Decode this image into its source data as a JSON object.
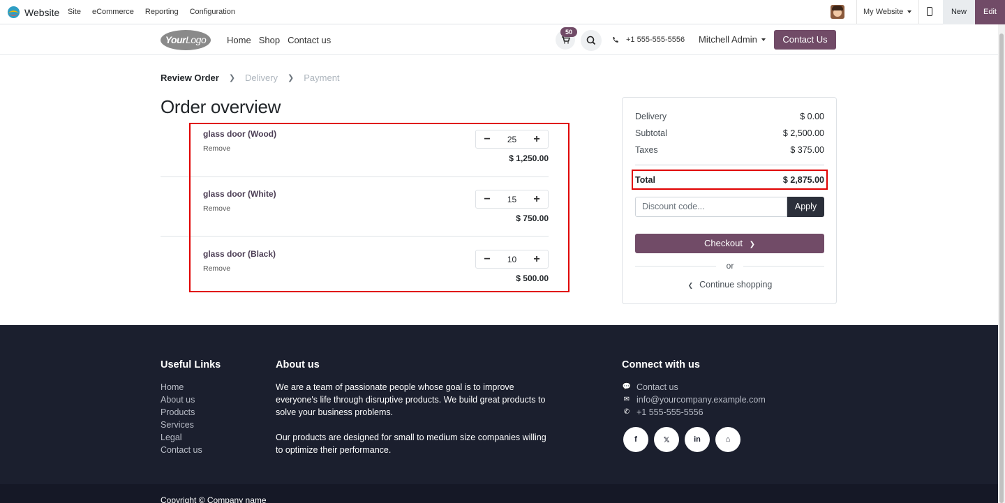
{
  "adminbar": {
    "app_name": "Website",
    "menu": [
      "Site",
      "eCommerce",
      "Reporting",
      "Configuration"
    ],
    "website_selector": "My Website",
    "new_label": "New",
    "edit_label": "Edit"
  },
  "header": {
    "logo_bold": "Your",
    "logo_thin": "Logo",
    "nav": [
      "Home",
      "Shop",
      "Contact us"
    ],
    "cart_count": "50",
    "phone": "+1 555-555-5556",
    "user": "Mitchell Admin",
    "contact_button": "Contact Us"
  },
  "steps": {
    "review": "Review Order",
    "delivery": "Delivery",
    "payment": "Payment"
  },
  "page_title": "Order overview",
  "order_lines": [
    {
      "name": "glass door (Wood)",
      "remove": "Remove",
      "qty": "25",
      "price": "$ 1,250.00"
    },
    {
      "name": "glass door (White)",
      "remove": "Remove",
      "qty": "15",
      "price": "$ 750.00"
    },
    {
      "name": "glass door (Black)",
      "remove": "Remove",
      "qty": "10",
      "price": "$ 500.00"
    }
  ],
  "summary": {
    "delivery_label": "Delivery",
    "delivery_value": "$ 0.00",
    "subtotal_label": "Subtotal",
    "subtotal_value": "$ 2,500.00",
    "taxes_label": "Taxes",
    "taxes_value": "$ 375.00",
    "total_label": "Total",
    "total_value": "$ 2,875.00",
    "discount_placeholder": "Discount code...",
    "apply_label": "Apply",
    "checkout_label": "Checkout",
    "or_label": "or",
    "continue_label": "Continue shopping"
  },
  "footer": {
    "useful_links_title": "Useful Links",
    "useful_links": [
      "Home",
      "About us",
      "Products",
      "Services",
      "Legal",
      "Contact us"
    ],
    "about_title": "About us",
    "about_p1": "We are a team of passionate people whose goal is to improve everyone's life through disruptive products. We build great products to solve your business problems.",
    "about_p2": "Our products are designed for small to medium size companies willing to optimize their performance.",
    "connect_title": "Connect with us",
    "connect_contact": "Contact us",
    "connect_email": "info@yourcompany.example.com",
    "connect_phone": "+1 555-555-5556",
    "socials": [
      "f",
      "𝕏",
      "in",
      "⌂"
    ],
    "copyright": "Copyright © Company name"
  },
  "colors": {
    "brand": "#714b67",
    "footer_bg": "#1b1f2e",
    "highlight": "#e00000"
  }
}
